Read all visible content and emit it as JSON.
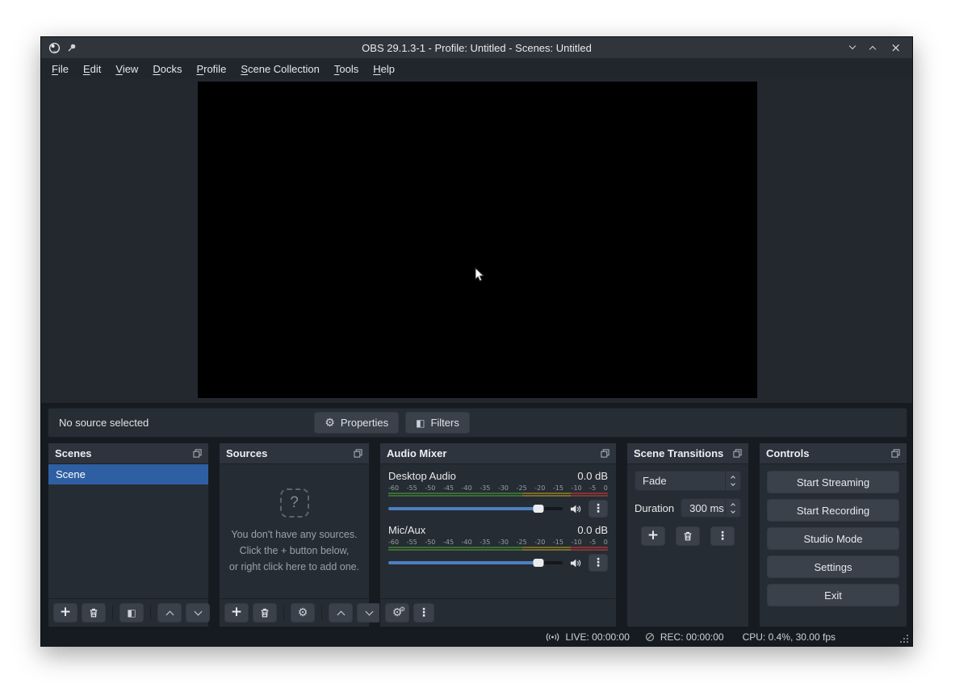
{
  "window": {
    "title": "OBS 29.1.3-1 - Profile: Untitled - Scenes: Untitled"
  },
  "menubar": {
    "items": [
      {
        "accel": "F",
        "rest": "ile"
      },
      {
        "accel": "E",
        "rest": "dit"
      },
      {
        "accel": "V",
        "rest": "iew"
      },
      {
        "accel": "D",
        "rest": "ocks"
      },
      {
        "accel": "P",
        "rest": "rofile"
      },
      {
        "accel": "S",
        "rest": "cene Collection"
      },
      {
        "accel": "T",
        "rest": "ools"
      },
      {
        "accel": "H",
        "rest": "elp"
      }
    ]
  },
  "source_toolbar": {
    "status": "No source selected",
    "properties_label": "Properties",
    "filters_label": "Filters"
  },
  "scenes": {
    "title": "Scenes",
    "items": [
      {
        "label": "Scene"
      }
    ]
  },
  "sources": {
    "title": "Sources",
    "placeholder_glyph": "?",
    "empty_lines": [
      "You don't have any sources.",
      "Click the + button below,",
      "or right click here to add one."
    ]
  },
  "audio_mixer": {
    "title": "Audio Mixer",
    "scale_ticks": [
      "-60",
      "-55",
      "-50",
      "-45",
      "-40",
      "-35",
      "-30",
      "-25",
      "-20",
      "-15",
      "-10",
      "-5",
      "0"
    ],
    "channels": [
      {
        "name": "Desktop Audio",
        "level_db": "0.0 dB"
      },
      {
        "name": "Mic/Aux",
        "level_db": "0.0 dB"
      }
    ]
  },
  "scene_transitions": {
    "title": "Scene Transitions",
    "transition": "Fade",
    "duration_label": "Duration",
    "duration_value": "300 ms"
  },
  "controls": {
    "title": "Controls",
    "buttons": [
      {
        "label": "Start Streaming"
      },
      {
        "label": "Start Recording"
      },
      {
        "label": "Studio Mode"
      },
      {
        "label": "Settings"
      },
      {
        "label": "Exit"
      }
    ]
  },
  "statusbar": {
    "live": "LIVE: 00:00:00",
    "rec": "REC: 00:00:00",
    "cpu": "CPU: 0.4%, 30.00 fps"
  },
  "icons": {
    "gear": "⚙",
    "half_filled_square": "◧",
    "plus": "+",
    "kebab": "⋮",
    "close": "×"
  },
  "colors": {
    "accent": "#2e5fa3",
    "slider": "#4d7fbe"
  }
}
